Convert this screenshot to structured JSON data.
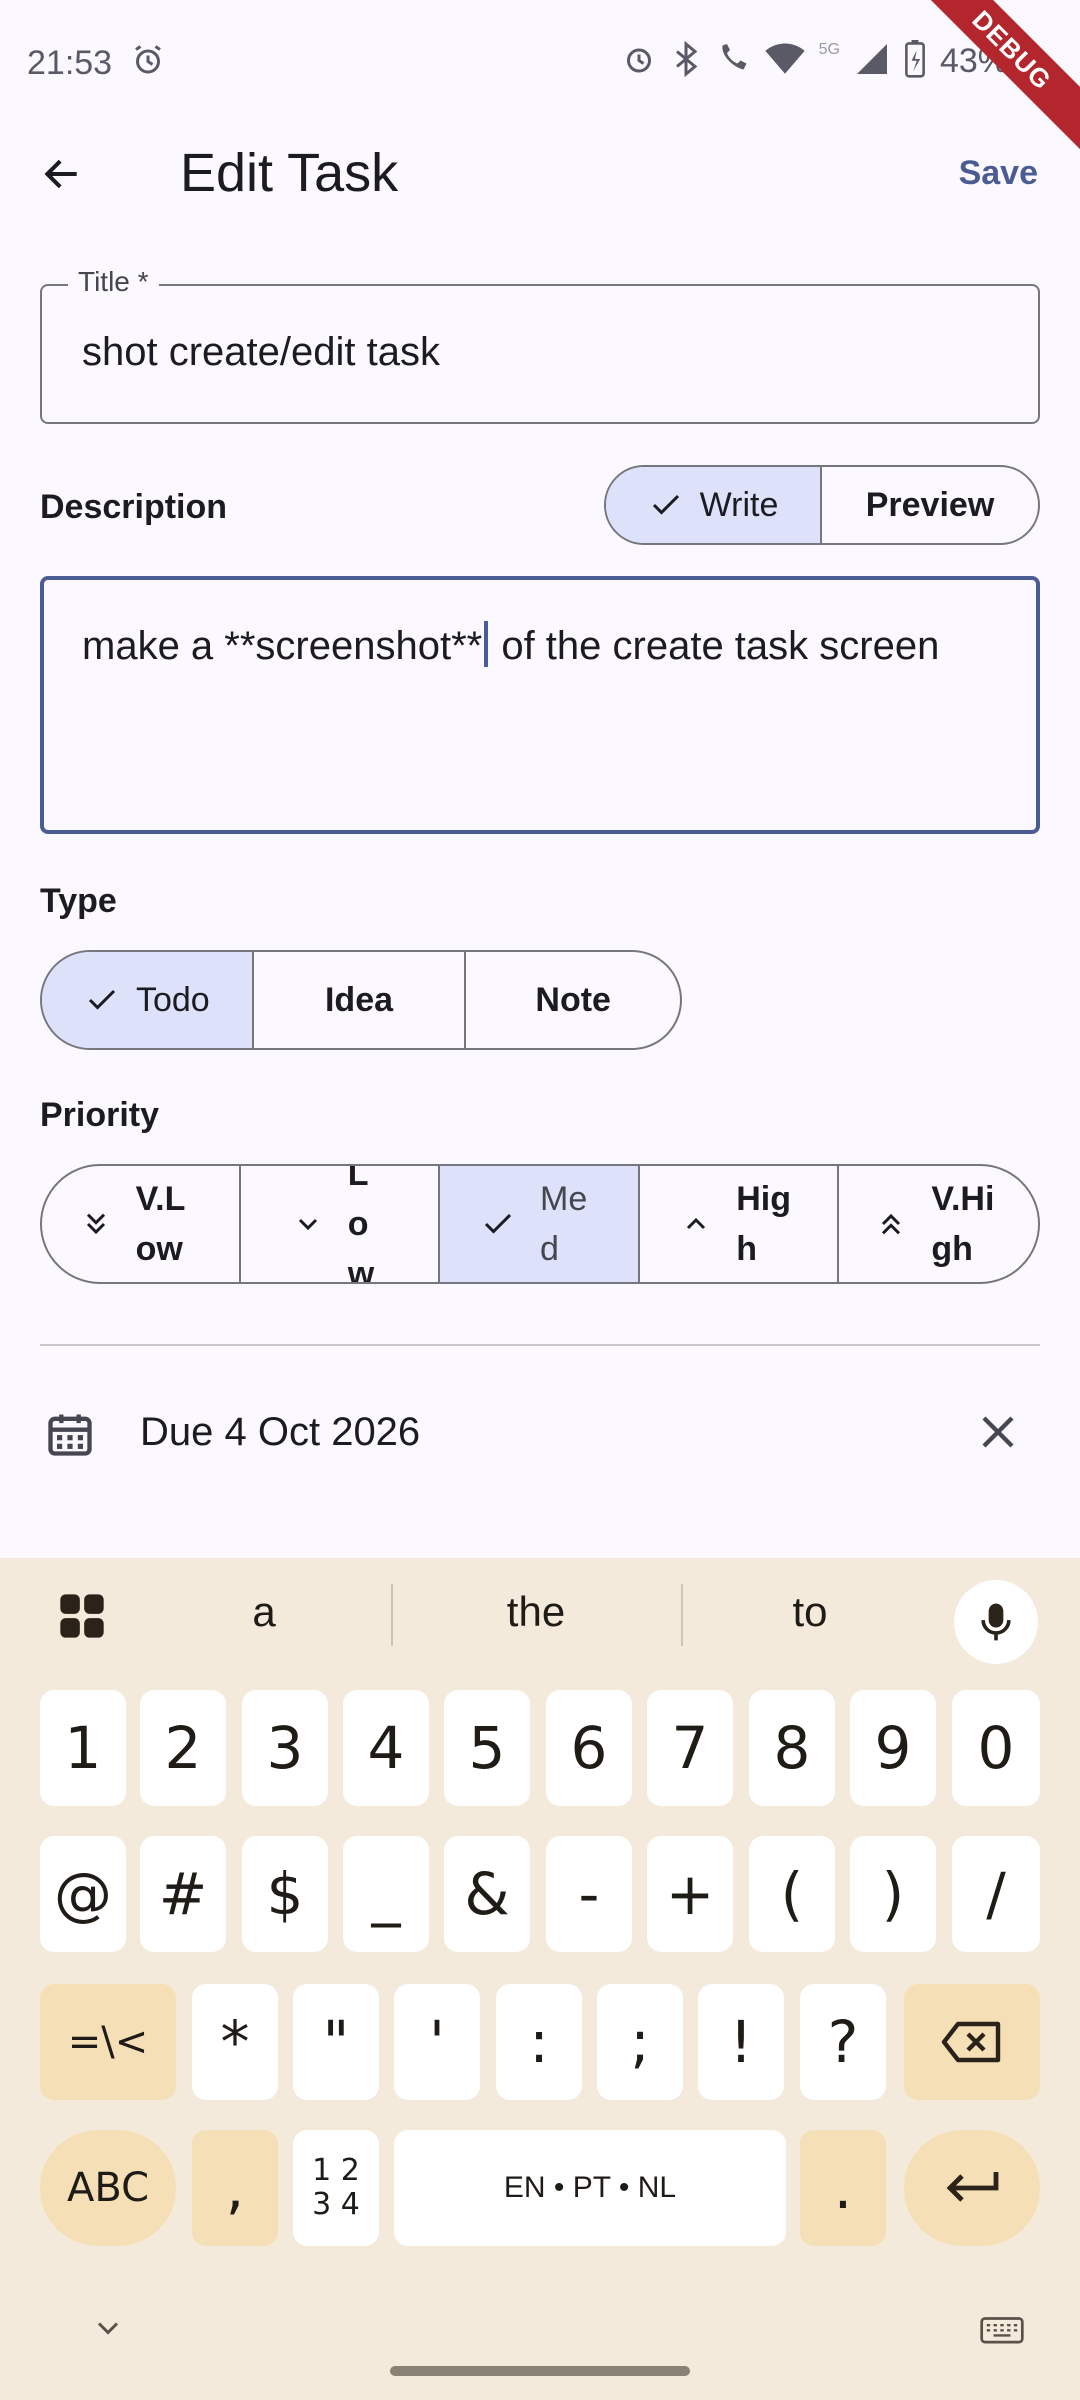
{
  "status_bar": {
    "time": "21:53",
    "battery": "43%",
    "network": "5G",
    "debug_banner": "DEBUG"
  },
  "app_bar": {
    "title": "Edit Task",
    "save_label": "Save",
    "back_icon": "arrow-back-icon"
  },
  "title_field": {
    "label": "Title *",
    "value": "shot create/edit task"
  },
  "description": {
    "label": "Description",
    "modes": [
      {
        "label": "Write",
        "selected": true
      },
      {
        "label": "Preview",
        "selected": false
      }
    ],
    "value_before_cursor": "make a **screenshot**",
    "value_after_cursor": " of the create task screen"
  },
  "type": {
    "label": "Type",
    "options": [
      {
        "label": "Todo",
        "selected": true
      },
      {
        "label": "Idea",
        "selected": false
      },
      {
        "label": "Note",
        "selected": false
      }
    ]
  },
  "priority": {
    "label": "Priority",
    "options": [
      {
        "label": "V.Low",
        "icon": "double-chevron-down-icon",
        "selected": false
      },
      {
        "label": "Low",
        "icon": "chevron-down-icon",
        "selected": false
      },
      {
        "label": "Med",
        "icon": "check-icon",
        "selected": true
      },
      {
        "label": "High",
        "icon": "chevron-up-icon",
        "selected": false
      },
      {
        "label": "V.High",
        "icon": "double-chevron-up-icon",
        "selected": false
      }
    ]
  },
  "due": {
    "text": "Due 4 Oct 2026",
    "icon": "calendar-icon",
    "clear_icon": "close-icon"
  },
  "keyboard": {
    "suggestions": [
      "a",
      "the",
      "to"
    ],
    "row1": [
      "1",
      "2",
      "3",
      "4",
      "5",
      "6",
      "7",
      "8",
      "9",
      "0"
    ],
    "row2": [
      "@",
      "#",
      "$",
      "_",
      "&",
      "-",
      "+",
      "(",
      ")",
      "/"
    ],
    "row3": [
      "=\\<",
      "*",
      "\"",
      "'",
      ":",
      ";",
      "!",
      "?"
    ],
    "abc": "ABC",
    "comma": ",",
    "numpad_label_top": "1 2",
    "numpad_label_bottom": "3 4",
    "space_label": "EN • PT • NL",
    "period": "."
  },
  "colors": {
    "primary": "#4a5c92",
    "selected_segment": "#dde1f9",
    "keyboard_bg": "#f4eadc",
    "keyboard_fn_key": "#f5dfb6",
    "debug_ribbon": "#b3262d"
  }
}
